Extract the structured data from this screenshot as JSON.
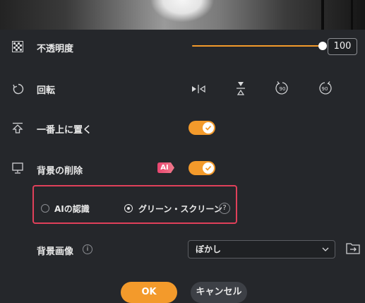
{
  "opacity": {
    "label": "不透明度",
    "value": "100",
    "level": 1.0
  },
  "rotate": {
    "label": "回転",
    "buttons": [
      "flip-horizontal-icon",
      "flip-vertical-icon",
      "rotate-left-90-icon",
      "rotate-right-90-icon"
    ],
    "left_text": "90",
    "right_text": "90"
  },
  "always_on_top": {
    "label": "一番上に置く",
    "enabled": true
  },
  "bg_removal": {
    "label": "背景の削除",
    "badge": "AI",
    "enabled": true,
    "options": [
      {
        "label": "AIの認識",
        "selected": false
      },
      {
        "label": "グリーン・スクリーン",
        "selected": true
      }
    ],
    "help": "?"
  },
  "bg_image": {
    "label": "背景画像",
    "info": "i",
    "selected": "ぼかし"
  },
  "buttons": {
    "ok": "OK",
    "cancel": "キャンセル"
  },
  "colors": {
    "accent": "#f39a2b",
    "highlight": "#e0405a",
    "background": "#25272b"
  }
}
